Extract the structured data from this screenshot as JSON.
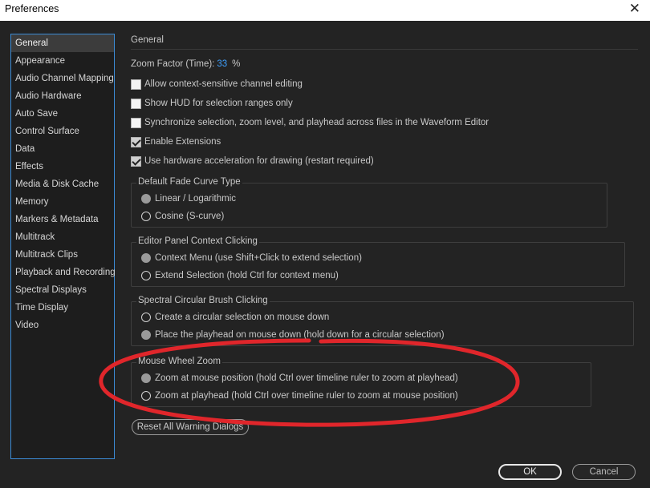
{
  "window": {
    "title": "Preferences",
    "close_glyph": "✕"
  },
  "sidebar": {
    "items": [
      {
        "label": "General",
        "selected": true
      },
      {
        "label": "Appearance"
      },
      {
        "label": "Audio Channel Mapping"
      },
      {
        "label": "Audio Hardware"
      },
      {
        "label": "Auto Save"
      },
      {
        "label": "Control Surface"
      },
      {
        "label": "Data"
      },
      {
        "label": "Effects"
      },
      {
        "label": "Media & Disk Cache"
      },
      {
        "label": "Memory"
      },
      {
        "label": "Markers & Metadata"
      },
      {
        "label": "Multitrack"
      },
      {
        "label": "Multitrack Clips"
      },
      {
        "label": "Playback and Recording"
      },
      {
        "label": "Spectral Displays"
      },
      {
        "label": "Time Display"
      },
      {
        "label": "Video"
      }
    ]
  },
  "general": {
    "title": "General",
    "zoom_label": "Zoom Factor (Time):",
    "zoom_value": "33",
    "zoom_unit": "%",
    "checkboxes": [
      {
        "label": "Allow context-sensitive channel editing",
        "checked": false
      },
      {
        "label": "Show HUD for selection ranges only",
        "checked": false
      },
      {
        "label": "Synchronize selection, zoom level, and playhead across files in the Waveform Editor",
        "checked": false
      },
      {
        "label": "Enable Extensions",
        "checked": true
      },
      {
        "label": "Use hardware acceleration for drawing (restart required)",
        "checked": true
      }
    ],
    "fade_curve": {
      "label": "Default Fade Curve Type",
      "options": [
        {
          "label": "Linear / Logarithmic",
          "selected": true
        },
        {
          "label": "Cosine (S-curve)",
          "selected": false
        }
      ]
    },
    "editor_click": {
      "label": "Editor Panel Context Clicking",
      "options": [
        {
          "label": "Context Menu (use Shift+Click to extend selection)",
          "selected": true
        },
        {
          "label": "Extend Selection (hold Ctrl for context menu)",
          "selected": false
        }
      ]
    },
    "spectral_brush": {
      "label": "Spectral Circular Brush Clicking",
      "options": [
        {
          "label": "Create a circular selection on mouse down",
          "selected": false
        },
        {
          "label": "Place the playhead on mouse down (hold down for a circular selection)",
          "selected": true
        }
      ]
    },
    "mouse_wheel": {
      "label": "Mouse Wheel Zoom",
      "options": [
        {
          "label": "Zoom at mouse position (hold Ctrl over timeline ruler to zoom at playhead)",
          "selected": true
        },
        {
          "label": "Zoom at playhead (hold Ctrl over timeline ruler to zoom at mouse position)",
          "selected": false
        }
      ]
    },
    "reset_button": "Reset All Warning Dialogs"
  },
  "footer": {
    "ok": "OK",
    "cancel": "Cancel"
  },
  "colors": {
    "accent": "#3ea0ff",
    "annotation": "#e0262b",
    "background": "#232323"
  }
}
